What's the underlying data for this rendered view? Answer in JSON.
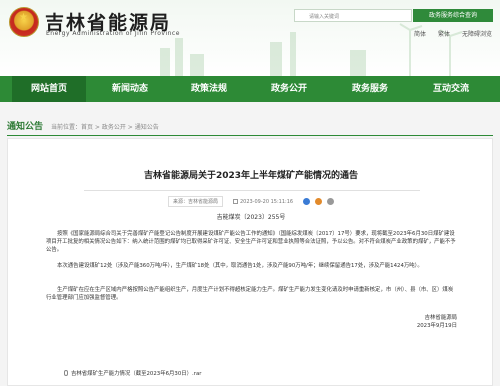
{
  "header": {
    "site_title": "吉林省能源局",
    "site_subtitle": "Energy Administration of Jilin Province",
    "search_placeholder": "请输入关键词",
    "search_button": "政务服务综合查询",
    "links": [
      "简体",
      "繁体",
      "无障碍浏览"
    ]
  },
  "nav": {
    "items": [
      {
        "label": "网站首页",
        "active": true
      },
      {
        "label": "新闻动态",
        "active": false
      },
      {
        "label": "政策法规",
        "active": false
      },
      {
        "label": "政务公开",
        "active": false
      },
      {
        "label": "政务服务",
        "active": false
      },
      {
        "label": "互动交流",
        "active": false
      }
    ]
  },
  "breadcrumb": {
    "title": "通知公告",
    "path": "当前位置：首页 > 政务公开 > 通知公告"
  },
  "article": {
    "title": "吉林省能源局关于2023年上半年煤矿产能情况的通告",
    "source": "来源：吉林省能源局",
    "date": "2023-09-20 15:11:16",
    "doc_no": "吉能煤炭〔2023〕255号",
    "paragraphs": [
      "按照《国家能源局综合司关于完善煤矿产能登记公告制度开展建设煤矿产能公告工作的通知》（国能综发煤炭〔2017〕17号）要求，现将截至2023年6月30日煤矿建设项目开工批复的相关情况公告如下：纳入统计范围的煤矿均已取得采矿许可证、安全生产许可证和营业执照等合法证照，予以公告。对不符合煤炭产业政策的煤矿，产能不予公告。",
      "本次通告建设煤矿12处（涉及产能360万吨/年），生产煤矿18处（其中，取消通告1处，涉及产能90万吨/年；继续保留通告17处，涉及产能1424万吨）。",
      "生产煤矿在应在生产区域内严格按照公告产能组织生产，月度生产计划不得超核定能力生产。煤矿生产能力发生变化请及时申请重新核定，市（州）、县（市、区）煤炭行业管理部门应加强监督管理。"
    ],
    "signature": "吉林省能源局",
    "sign_date": "2023年9月19日",
    "attachment": "吉林省煤矿生产能力情况（截至2023年6月30日）.rar"
  }
}
